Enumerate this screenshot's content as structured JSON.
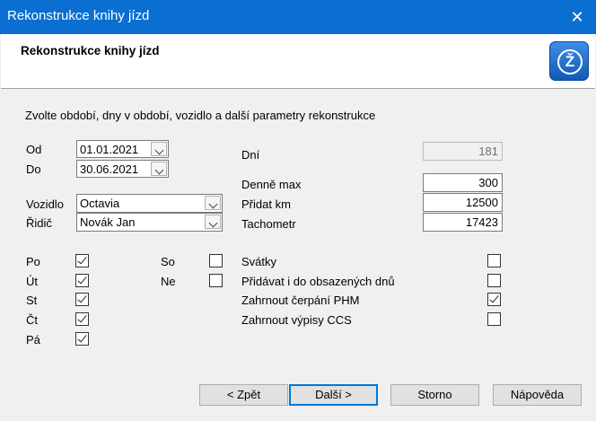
{
  "window": {
    "title": "Rekonstrukce knihy jízd",
    "close_glyph": "✕"
  },
  "header": {
    "title": "Rekonstrukce knihy jízd",
    "logo_icon": "app-logo-icon"
  },
  "instruction": "Zvolte období, dny v období, vozidlo a další parametry rekonstrukce",
  "period": {
    "od_label": "Od",
    "od_value": "01.01.2021",
    "do_label": "Do",
    "do_value": "30.06.2021"
  },
  "vehicle": {
    "vozidlo_label": "Vozidlo",
    "vozidlo_value": "Octavia",
    "ridic_label": "Řidič",
    "ridic_value": "Novák Jan"
  },
  "days": {
    "po": {
      "label": "Po",
      "checked": true
    },
    "ut": {
      "label": "Út",
      "checked": true
    },
    "st": {
      "label": "St",
      "checked": true
    },
    "ct": {
      "label": "Čt",
      "checked": true
    },
    "pa": {
      "label": "Pá",
      "checked": true
    },
    "so": {
      "label": "So",
      "checked": false
    },
    "ne": {
      "label": "Ne",
      "checked": false
    }
  },
  "params": {
    "dni_label": "Dní",
    "dni_value": "181",
    "denne_max_label": "Denně max",
    "denne_max_value": "300",
    "pridat_km_label": "Přidat km",
    "pridat_km_value": "12500",
    "tachometr_label": "Tachometr",
    "tachometr_value": "17423"
  },
  "options": {
    "svatky": {
      "label": "Svátky",
      "checked": false
    },
    "pridavat": {
      "label": "Přidávat i do obsazených dnů",
      "checked": false
    },
    "phm": {
      "label": "Zahrnout čerpání PHM",
      "checked": true
    },
    "ccs": {
      "label": "Zahrnout výpisy CCS",
      "checked": false
    }
  },
  "buttons": {
    "back": "< Zpět",
    "next": "Další >",
    "cancel": "Storno",
    "help": "Nápověda"
  }
}
